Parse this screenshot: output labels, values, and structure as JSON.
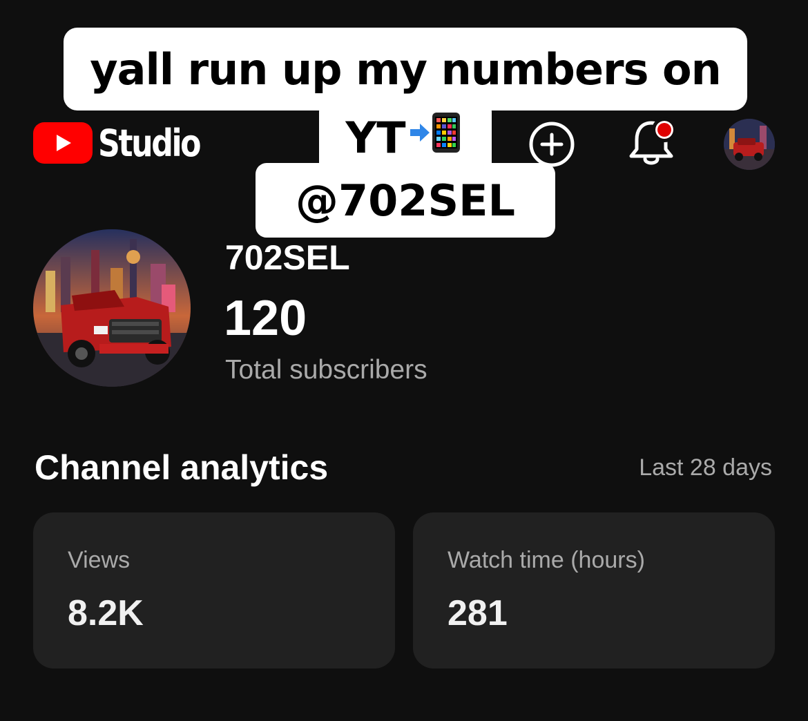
{
  "caption": {
    "line1": "yall run up my numbers on",
    "line2": "YT",
    "line3": "@702SEL"
  },
  "header": {
    "logo_text": "Studio",
    "icons": [
      "create-icon",
      "notifications-icon",
      "account-avatar"
    ],
    "brand_color": "#ff0000",
    "notification_dot_color": "#e00000"
  },
  "channel": {
    "name": "702SEL",
    "subscriber_count": "120",
    "subscriber_label": "Total subscribers"
  },
  "analytics": {
    "title": "Channel analytics",
    "period": "Last 28 days",
    "cards": [
      {
        "label": "Views",
        "value": "8.2K"
      },
      {
        "label": "Watch time (hours)",
        "value": "281"
      }
    ]
  }
}
